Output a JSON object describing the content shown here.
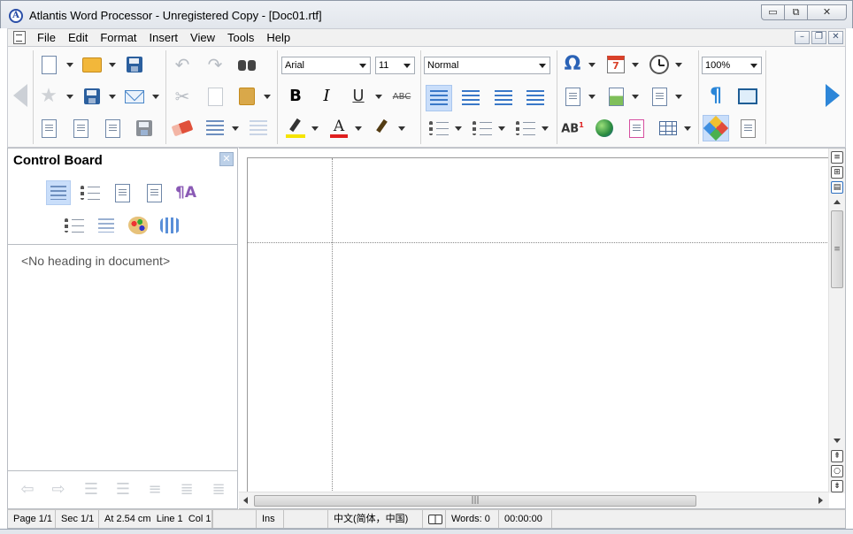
{
  "window": {
    "title": "Atlantis Word Processor - Unregistered Copy - [Doc01.rtf]",
    "logo_letter": "A",
    "min_glyph": "▭",
    "max_glyph": "⧉",
    "close_glyph": "✕"
  },
  "menu": {
    "items": [
      "File",
      "Edit",
      "Format",
      "Insert",
      "View",
      "Tools",
      "Help"
    ],
    "mdi_min": "–",
    "mdi_restore": "❐",
    "mdi_close": "✕"
  },
  "toolbar": {
    "font_name": "Arial",
    "font_size": "11",
    "style": "Normal",
    "zoom": "100%",
    "bold_label": "B",
    "italic_label": "I",
    "underline_label": "U",
    "strike_label": "ABC",
    "font_color_label": "A",
    "omega_label": "Ω",
    "pilcrow_label": "¶",
    "ab_label": "AB",
    "calendar_label": "7"
  },
  "control_board": {
    "title": "Control Board",
    "close_glyph": "✕",
    "empty_message": "<No heading in document>",
    "pilcrow_a": "¶A"
  },
  "document": {
    "hscroll_grip": "|||",
    "vscroll_grip": "≡"
  },
  "statusbar": {
    "page": "Page 1/1",
    "section": "Sec 1/1",
    "position": "At 2.54 cm",
    "line": "Line 1",
    "column": "Col 1",
    "mode": "Ins",
    "language": "中文(简体，中国)",
    "words": "Words: 0",
    "time": "00:00:00"
  },
  "colors": {
    "accent_blue": "#2d86d8",
    "highlight_yellow": "#f5e400",
    "font_red": "#e01f1f",
    "pressed_bg": "#c9defa"
  }
}
